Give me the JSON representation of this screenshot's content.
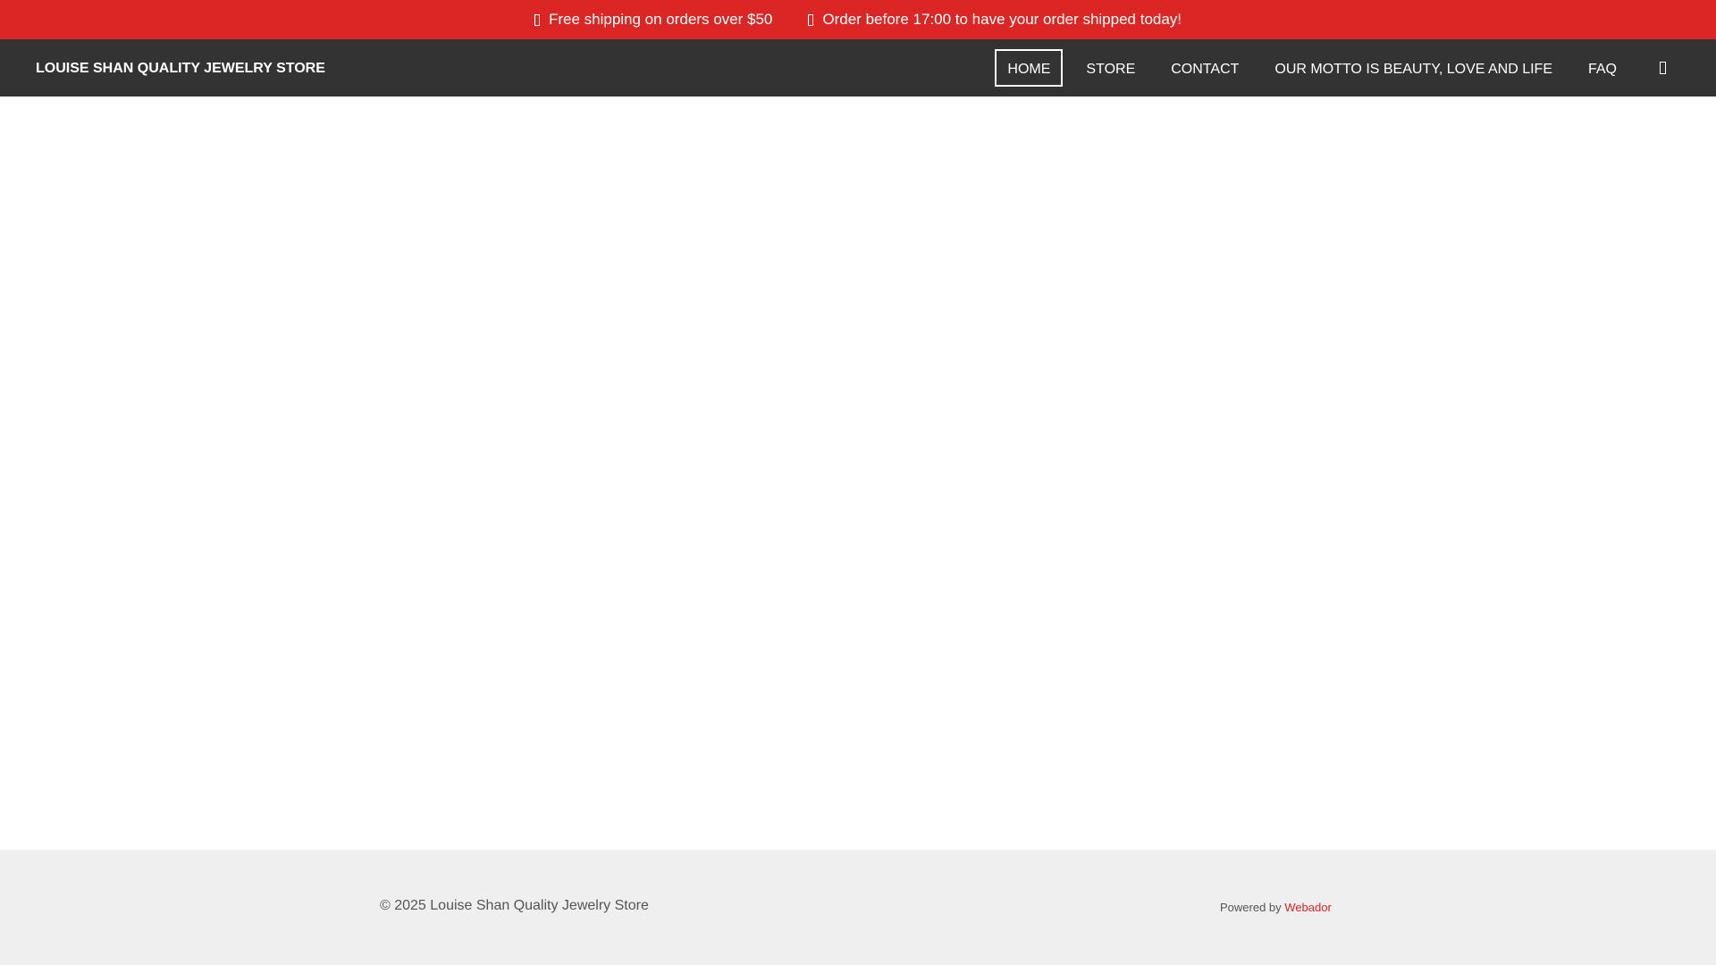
{
  "topbar": {
    "items": [
      {
        "icon": "check-icon",
        "text": "Free shipping on orders over $50"
      },
      {
        "icon": "clock-icon",
        "text": "Order before 17:00 to have your order shipped today!"
      }
    ]
  },
  "header": {
    "logo": "LOUISE SHAN QUALITY JEWELRY STORE",
    "menu": [
      "HOME",
      "STORE",
      "CONTACT",
      "OUR MOTTO IS BEAUTY, LOVE AND LIFE",
      "FAQ"
    ],
    "active": "HOME",
    "cart_icon": "cart-icon"
  },
  "footer": {
    "copyright": "© 2025 Louise Shan Quality Jewelry Store",
    "powered_prefix": "Powered by",
    "powered_link": "Webador"
  },
  "colors": {
    "accent": "#dc2626",
    "nav": "#333333",
    "footer": "#efefef"
  }
}
